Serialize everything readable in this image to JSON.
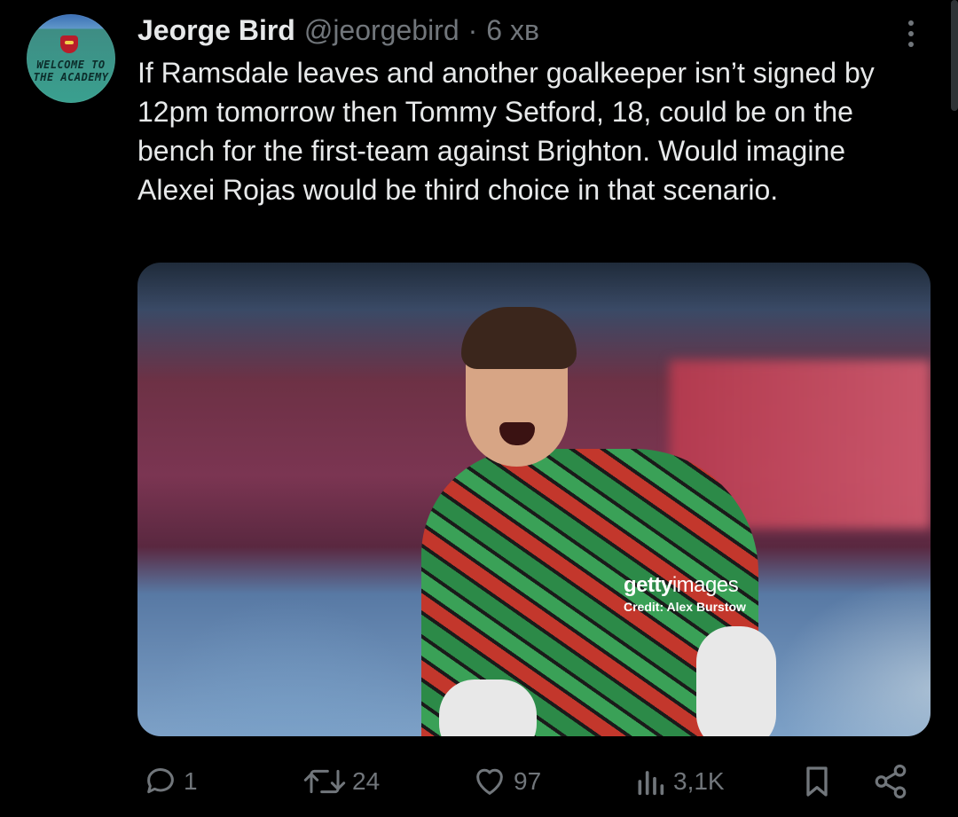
{
  "tweet": {
    "author_name": "Jeorge Bird",
    "handle": "@jeorgebird",
    "separator": "·",
    "time": "6 хв",
    "text": "If Ramsdale leaves and another goalkeeper isn’t signed by 12pm tomorrow then Tommy Setford, 18, could be on the bench for the first-team against Brighton. Would imagine Alexei Rojas would be third choice in that scenario."
  },
  "avatar": {
    "sign_line1": "WELCOME TO",
    "sign_line2": "THE ACADEMY"
  },
  "media": {
    "watermark_brand_bold": "getty",
    "watermark_brand_light": "images",
    "watermark_credit": "Credit: Alex Burstow"
  },
  "actions": {
    "reply_count": "1",
    "retweet_count": "24",
    "like_count": "97",
    "views_count": "3,1K"
  },
  "icons": {
    "reply": "reply-icon",
    "retweet": "retweet-icon",
    "like": "heart-icon",
    "views": "views-icon",
    "bookmark": "bookmark-icon",
    "share": "share-icon",
    "more": "more-icon"
  },
  "colors": {
    "background": "#000000",
    "text": "#e7e9ea",
    "muted": "#71767b"
  }
}
